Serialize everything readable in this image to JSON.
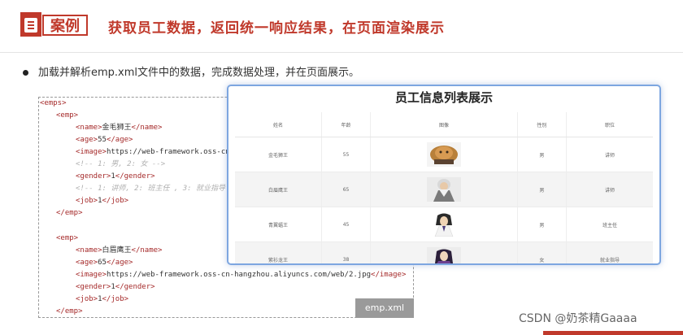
{
  "header": {
    "label": "案例",
    "title": "获取员工数据，返回统一响应结果，在页面渲染展示"
  },
  "bullet": "加载并解析emp.xml文件中的数据，完成数据处理，并在页面展示。",
  "code": {
    "filename": "emp.xml",
    "lines": [
      {
        "tag_open": "<emps>"
      },
      {
        "tag_open": "<emp>"
      },
      {
        "tag_open": "<name>",
        "text": "金毛狮王",
        "tag_close": "</name>"
      },
      {
        "tag_open": "<age>",
        "text": "55",
        "tag_close": "</age>"
      },
      {
        "tag_open": "<image>",
        "text": "https://web-framework.oss-cn"
      },
      {
        "comment": "<!-- 1: 男, 2: 女 -->"
      },
      {
        "tag_open": "<gender>",
        "text": "1",
        "tag_close": "</gender>"
      },
      {
        "comment": "<!-- 1: 讲师, 2: 班主任 , 3: 就业指导"
      },
      {
        "tag_open": "<job>",
        "text": "1",
        "tag_close": "</job>"
      },
      {
        "tag_open": "</emp>"
      },
      {
        "tag_open": "<emp>"
      },
      {
        "tag_open": "<name>",
        "text": "白眉鹰王",
        "tag_close": "</name>"
      },
      {
        "tag_open": "<age>",
        "text": "65",
        "tag_close": "</age>"
      },
      {
        "tag_open": "<image>",
        "text": "https://web-framework.oss-cn-hangzhou.aliyuncs.com/web/2.jpg",
        "tag_close": "</image>"
      },
      {
        "tag_open": "<gender>",
        "text": "1",
        "tag_close": "</gender>"
      },
      {
        "tag_open": "<job>",
        "text": "1",
        "tag_close": "</job>"
      },
      {
        "tag_open": "</emp>"
      }
    ]
  },
  "panel": {
    "title": "员工信息列表展示",
    "columns": [
      "姓名",
      "年龄",
      "图像",
      "性别",
      "职位"
    ],
    "rows": [
      {
        "name": "金毛狮王",
        "age": "55",
        "avatar": "lion-avatar",
        "gender": "男",
        "job": "讲师"
      },
      {
        "name": "白眉鹰王",
        "age": "65",
        "avatar": "white-eyebrow-avatar",
        "gender": "男",
        "job": "讲师"
      },
      {
        "name": "青翼蝠王",
        "age": "45",
        "avatar": "bat-king-avatar",
        "gender": "男",
        "job": "班主任"
      },
      {
        "name": "紫衫龙王",
        "age": "38",
        "avatar": "purple-dragon-avatar",
        "gender": "女",
        "job": "就业指导"
      }
    ]
  },
  "watermark": "CSDN @奶茶精Gaaaa",
  "colors": {
    "accent": "#c0392b",
    "panel_border": "#7da6e0",
    "file_tag": "#9a9a9a"
  }
}
